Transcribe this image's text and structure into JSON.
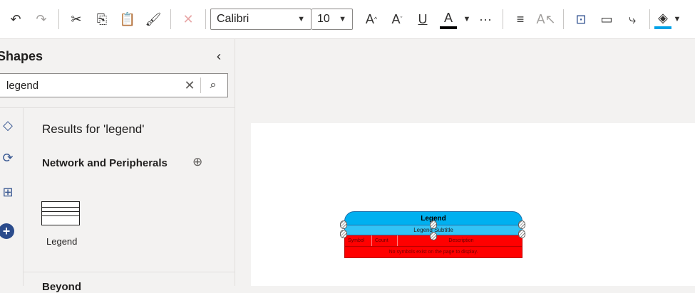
{
  "toolbar": {
    "undo_icon": "undo-icon",
    "redo_icon": "redo-icon",
    "font_name": "Calibri",
    "font_size": "10",
    "more": "···"
  },
  "sidebar": {
    "title": "Shapes",
    "search_value": "legend",
    "results_label": "Results for 'legend'",
    "section_title": "Network and Peripherals",
    "stencil_label": "Legend",
    "section2_title": "Beyond"
  },
  "legend_shape": {
    "title": "Legend",
    "subtitle": "Legend Subtitle",
    "col_symbol": "Symbol",
    "col_count": "Count",
    "col_description": "Description",
    "empty_message": "No symbols exist on the page to display."
  },
  "colors": {
    "legend_header": "#00b0f0",
    "legend_body": "#ff0000",
    "accent": "#2b4c8c"
  }
}
